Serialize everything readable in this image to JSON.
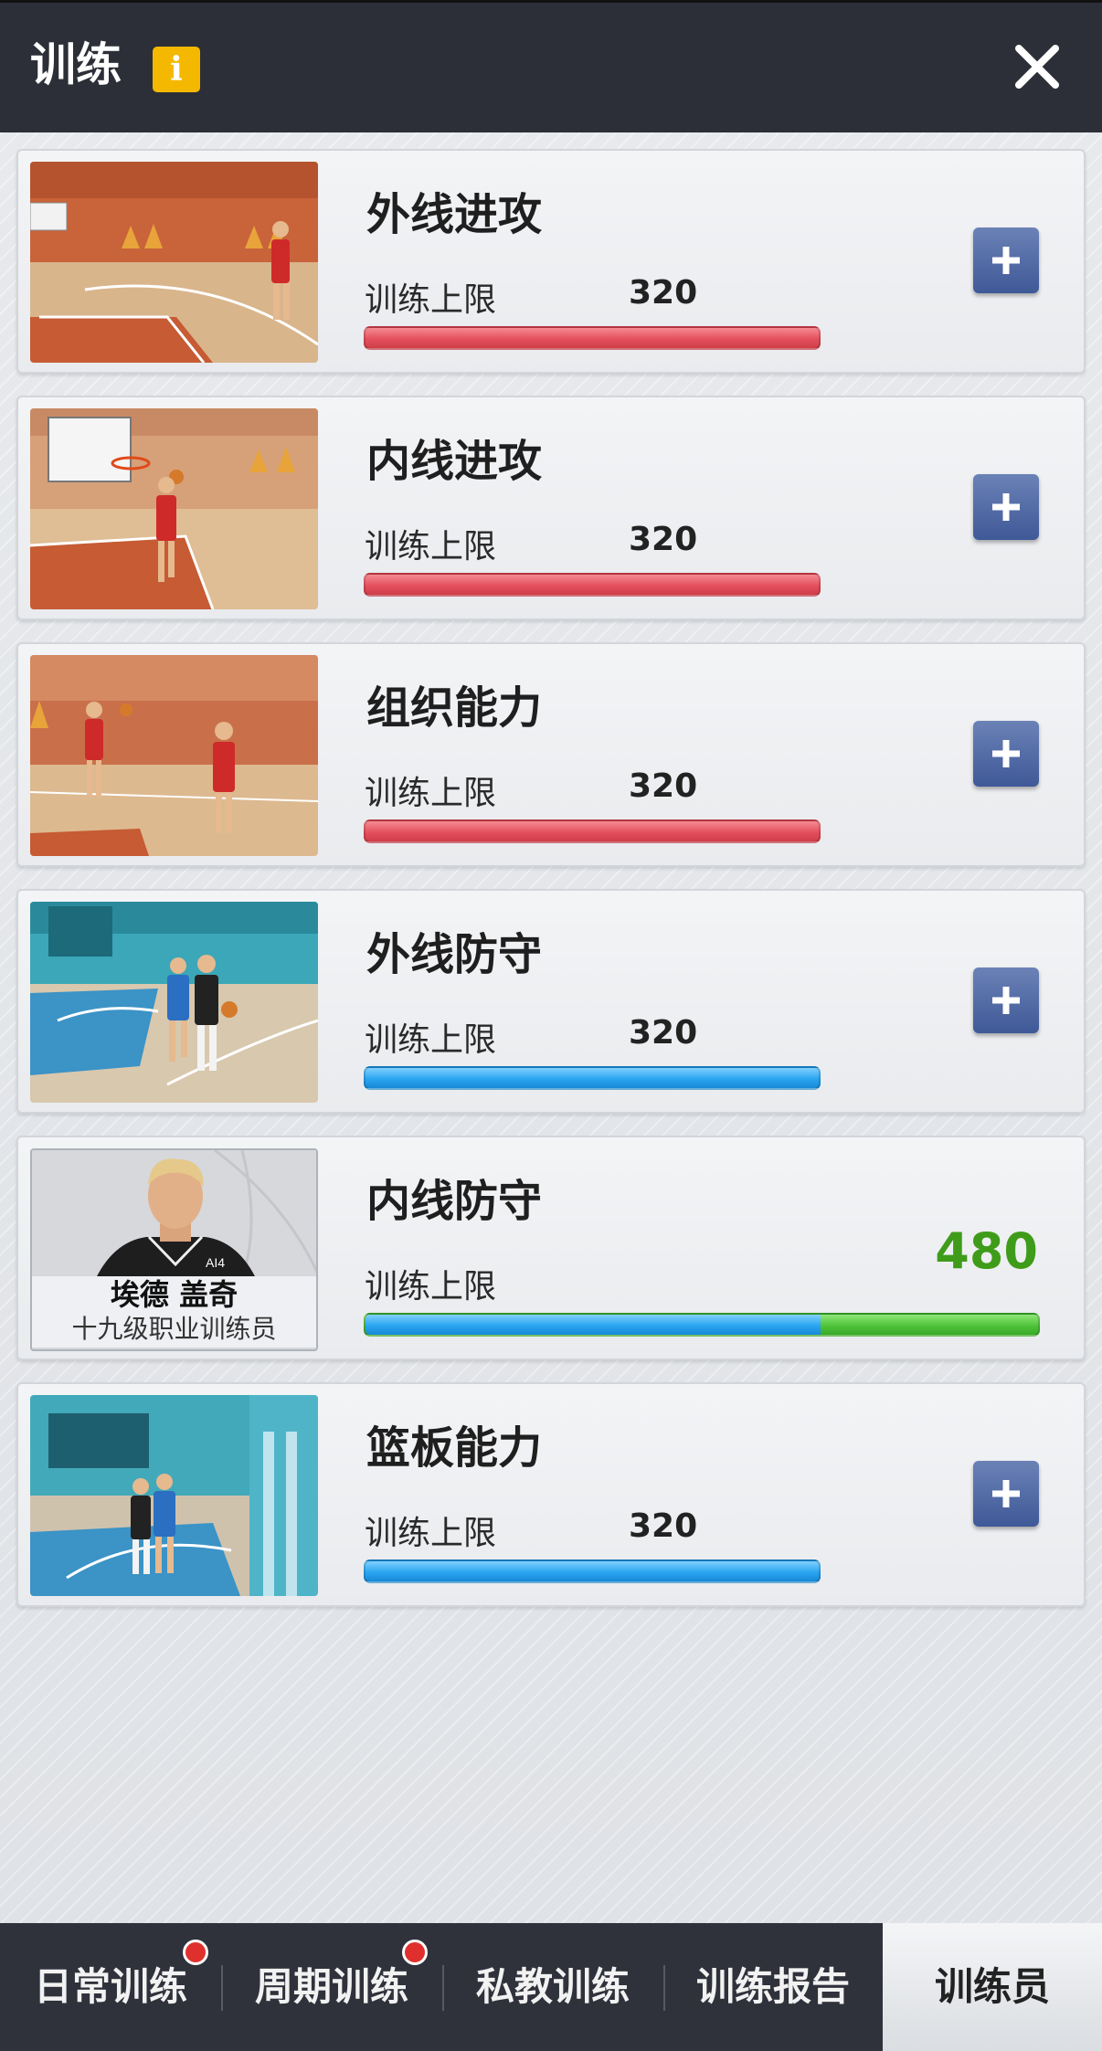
{
  "header": {
    "title": "训练",
    "info_icon": "info-icon",
    "close_icon": "close-icon",
    "info_color": "#f5b800"
  },
  "trainings": [
    {
      "name": "外线进攻",
      "limit_label": "训练上限",
      "limit_value": "320",
      "bar_color": "red",
      "image": "outside-offense-scene"
    },
    {
      "name": "内线进攻",
      "limit_label": "训练上限",
      "limit_value": "320",
      "bar_color": "red",
      "image": "inside-offense-scene"
    },
    {
      "name": "组织能力",
      "limit_label": "训练上限",
      "limit_value": "320",
      "bar_color": "red",
      "image": "playmaking-scene"
    },
    {
      "name": "外线防守",
      "limit_label": "训练上限",
      "limit_value": "320",
      "bar_color": "blue",
      "image": "outside-defense-scene"
    },
    {
      "name": "内线防守",
      "limit_label": "训练上限",
      "limit_value": "480",
      "bar_color": "blue+green",
      "trainer_name": "埃德 盖奇",
      "trainer_rank": "十九级职业训练员",
      "jersey_text": "AI4"
    },
    {
      "name": "篮板能力",
      "limit_label": "训练上限",
      "limit_value": "320",
      "bar_color": "blue",
      "image": "rebound-scene"
    }
  ],
  "tabs": [
    {
      "label": "日常训练",
      "badge": true
    },
    {
      "label": "周期训练",
      "badge": true
    },
    {
      "label": "私教训练",
      "badge": false
    },
    {
      "label": "训练报告",
      "badge": false
    },
    {
      "label": "训练员",
      "badge": false,
      "active": true
    }
  ],
  "colors": {
    "header_bg": "#2c2f37",
    "plus_button": "#4f67a4",
    "bar_red": "#e4505d",
    "bar_blue": "#2aa5f0",
    "bar_green": "#4fc43a",
    "value_green": "#3f9c1a",
    "badge_red": "#e0302d"
  }
}
